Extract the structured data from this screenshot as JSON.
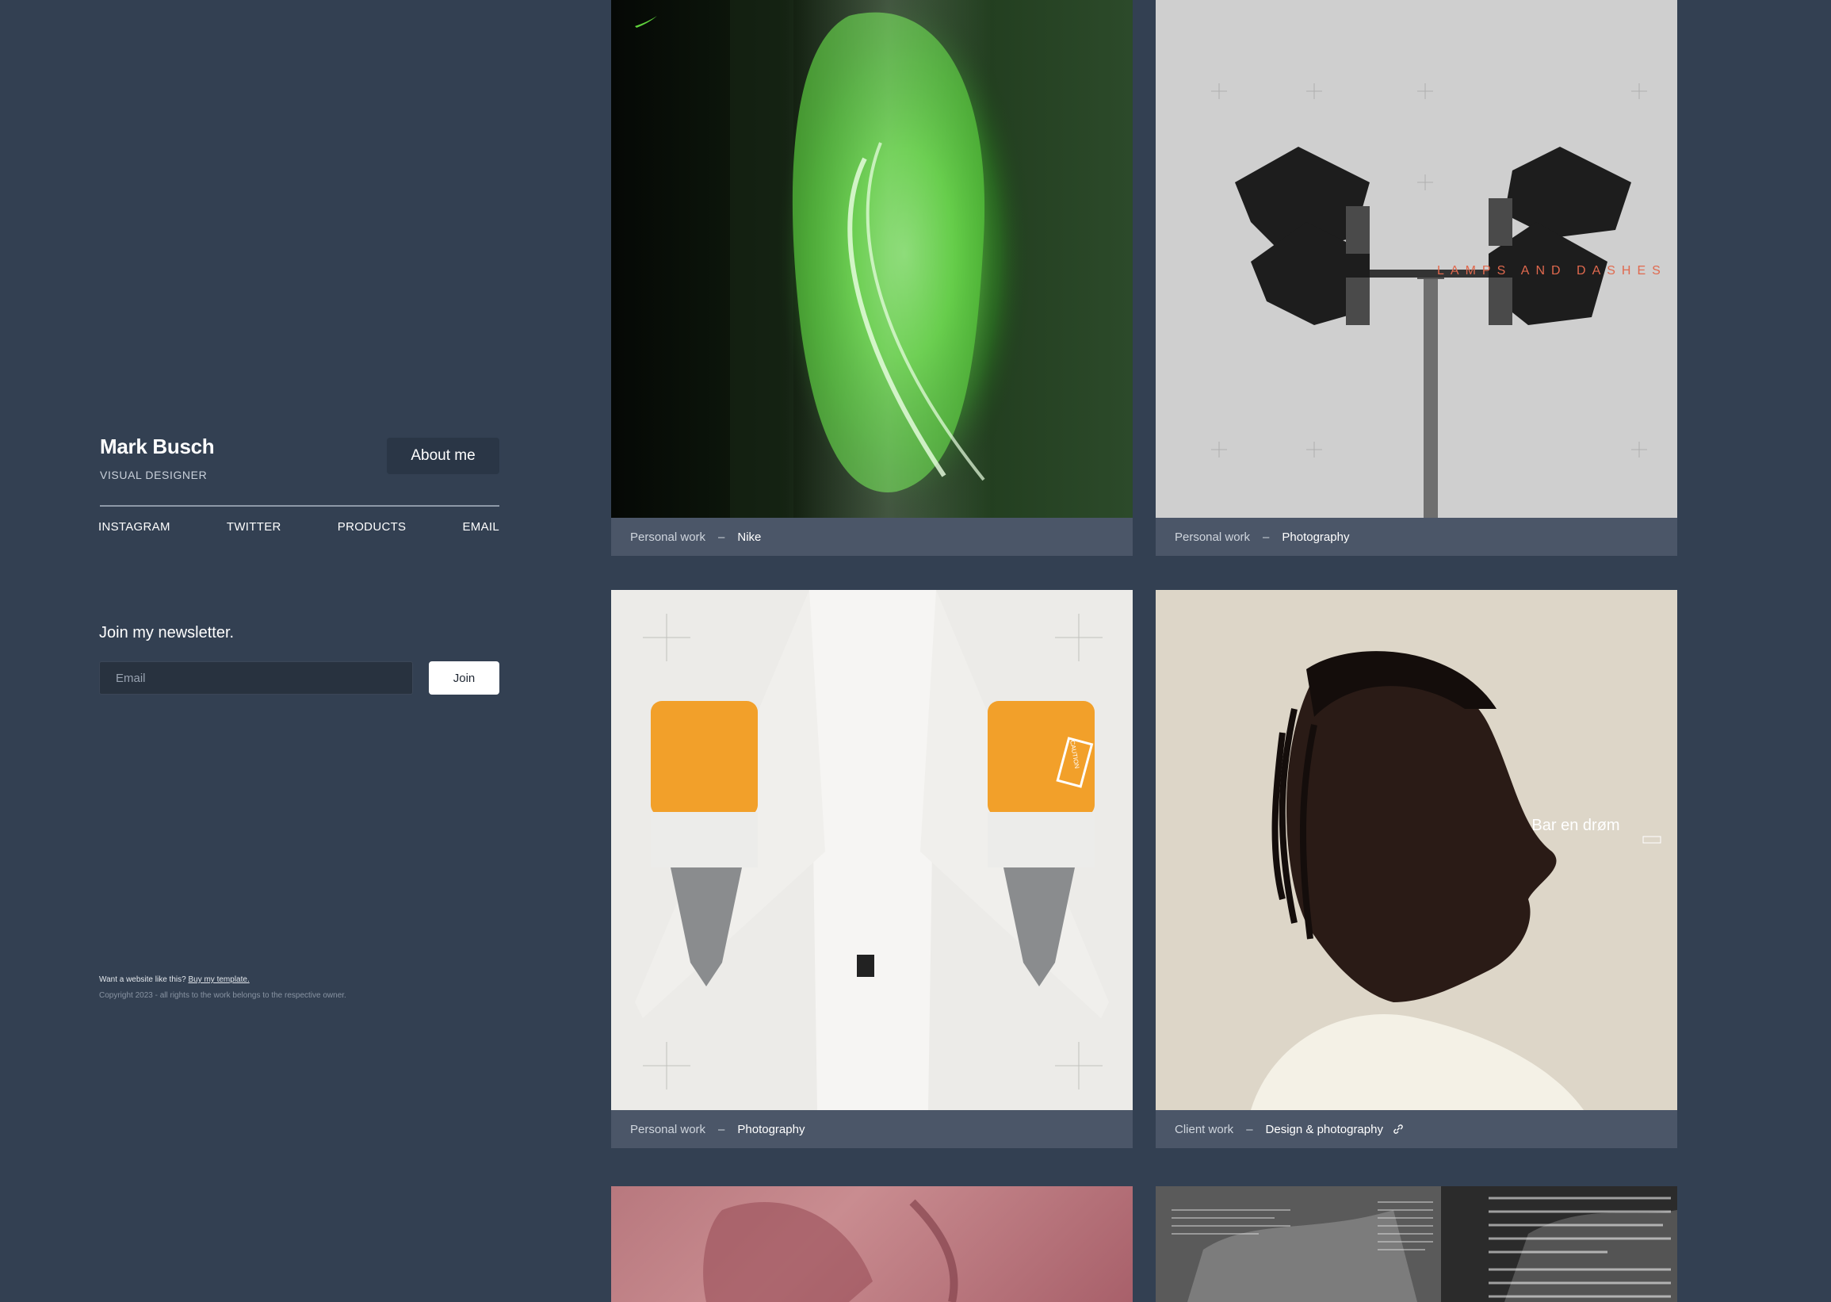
{
  "profile": {
    "name": "Mark Busch",
    "role": "VISUAL DESIGNER",
    "about_label": "About me"
  },
  "social": {
    "instagram": "INSTAGRAM",
    "twitter": "TWITTER",
    "products": "PRODUCTS",
    "email": "EMAIL"
  },
  "newsletter": {
    "title": "Join my newsletter.",
    "email_placeholder": "Email",
    "join_label": "Join"
  },
  "footer": {
    "prompt": "Want a website like this?",
    "link": "Buy my template.",
    "copyright": "Copyright 2023 - all rights to the work belongs to the respective owner."
  },
  "cards": [
    {
      "category": "Personal work",
      "dash": "–",
      "title": "Nike"
    },
    {
      "category": "Personal work",
      "dash": "–",
      "title": "Photography",
      "overlay": "LAMPS AND DASHES"
    },
    {
      "category": "Personal work",
      "dash": "–",
      "title": "Photography",
      "overlay": "CAUTION"
    },
    {
      "category": "Client work",
      "dash": "–",
      "title": "Design & photography",
      "overlay": "Bar en drøm",
      "icon": "link-icon"
    }
  ],
  "colors": {
    "background": "#334052",
    "caption_bar": "#4b5668",
    "nike_green": "#5fd13c",
    "lamps_text": "#e0694e"
  }
}
